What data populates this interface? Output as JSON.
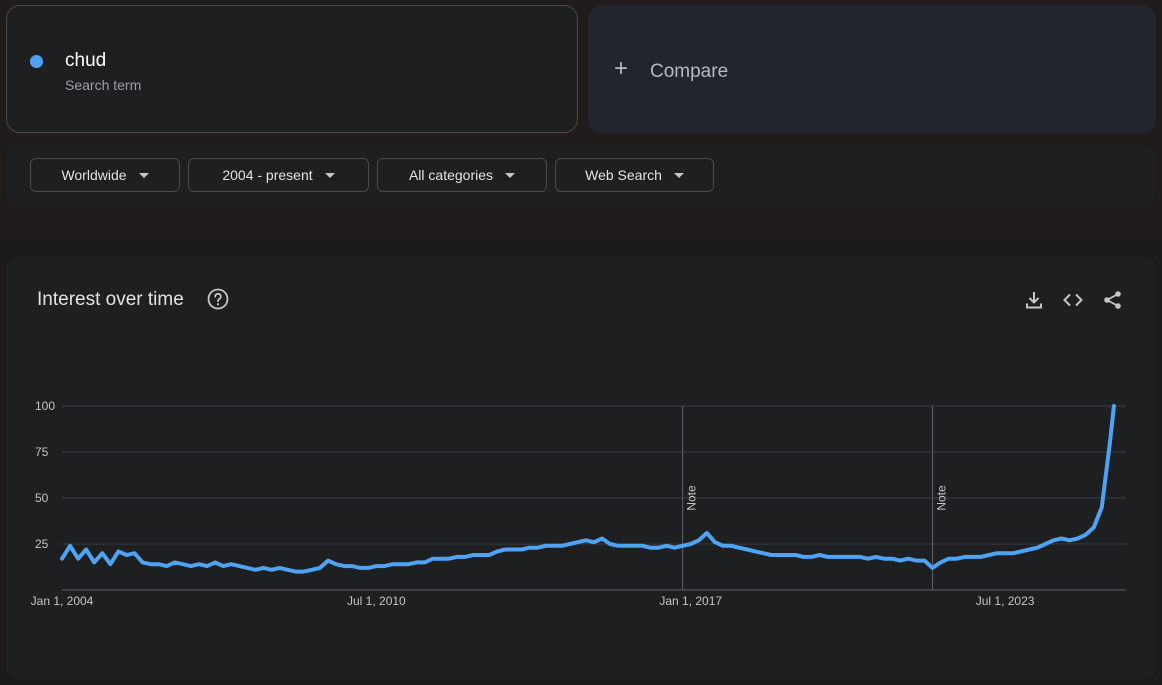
{
  "search_term": {
    "name": "chud",
    "subtitle": "Search term",
    "color": "#4ea3f5"
  },
  "compare": {
    "plus": "+",
    "label": "Compare"
  },
  "filters": {
    "region": "Worldwide",
    "time_range": "2004 - present",
    "category": "All categories",
    "search_type": "Web Search"
  },
  "chart_header": {
    "title": "Interest over time",
    "icons": [
      "help-icon",
      "download-icon",
      "embed-icon",
      "share-icon"
    ]
  },
  "chart_data": {
    "type": "line",
    "title": "",
    "xlabel": "",
    "ylabel": "",
    "ylim": [
      0,
      100
    ],
    "y_ticks": [
      100,
      75,
      50,
      25
    ],
    "x_tick_labels": [
      "Jan 1, 2004",
      "Jul 1, 2010",
      "Jan 1, 2017",
      "Jul 1, 2023"
    ],
    "x_tick_dates": [
      "2004-01",
      "2010-07",
      "2017-01",
      "2023-07"
    ],
    "grid": true,
    "legend": "none",
    "line_color": "#4ea3f5",
    "annotations": [
      {
        "label": "Note",
        "x": "2016-11"
      },
      {
        "label": "Note",
        "x": "2022-01"
      }
    ],
    "x": [
      "2004-01",
      "2004-03",
      "2004-05",
      "2004-07",
      "2004-09",
      "2004-11",
      "2005-01",
      "2005-03",
      "2005-05",
      "2005-07",
      "2005-09",
      "2005-11",
      "2006-01",
      "2006-03",
      "2006-05",
      "2006-07",
      "2006-09",
      "2006-11",
      "2007-01",
      "2007-03",
      "2007-05",
      "2007-07",
      "2007-09",
      "2007-11",
      "2008-01",
      "2008-03",
      "2008-05",
      "2008-07",
      "2008-09",
      "2008-11",
      "2009-01",
      "2009-03",
      "2009-05",
      "2009-07",
      "2009-09",
      "2009-11",
      "2010-01",
      "2010-03",
      "2010-05",
      "2010-07",
      "2010-09",
      "2010-11",
      "2011-01",
      "2011-03",
      "2011-05",
      "2011-07",
      "2011-09",
      "2011-11",
      "2012-01",
      "2012-03",
      "2012-05",
      "2012-07",
      "2012-09",
      "2012-11",
      "2013-01",
      "2013-03",
      "2013-05",
      "2013-07",
      "2013-09",
      "2013-11",
      "2014-01",
      "2014-03",
      "2014-05",
      "2014-07",
      "2014-09",
      "2014-11",
      "2015-01",
      "2015-03",
      "2015-05",
      "2015-07",
      "2015-09",
      "2015-11",
      "2016-01",
      "2016-03",
      "2016-05",
      "2016-07",
      "2016-09",
      "2016-11",
      "2017-01",
      "2017-03",
      "2017-05",
      "2017-07",
      "2017-09",
      "2017-11",
      "2018-01",
      "2018-03",
      "2018-05",
      "2018-07",
      "2018-09",
      "2018-11",
      "2019-01",
      "2019-03",
      "2019-05",
      "2019-07",
      "2019-09",
      "2019-11",
      "2020-01",
      "2020-03",
      "2020-05",
      "2020-07",
      "2020-09",
      "2020-11",
      "2021-01",
      "2021-03",
      "2021-05",
      "2021-07",
      "2021-09",
      "2021-11",
      "2022-01",
      "2022-03",
      "2022-05",
      "2022-07",
      "2022-09",
      "2022-11",
      "2023-01",
      "2023-03",
      "2023-05",
      "2023-07",
      "2023-09",
      "2023-11",
      "2024-01",
      "2024-03",
      "2024-05",
      "2024-07",
      "2024-09",
      "2024-11",
      "2025-01",
      "2025-03",
      "2025-05",
      "2025-07",
      "2025-09",
      "2025-10",
      "2025-11",
      "2025-12",
      "2026-01"
    ],
    "series": [
      {
        "values": [
          17,
          24,
          17,
          22,
          15,
          20,
          14,
          21,
          19,
          20,
          15,
          14,
          14,
          13,
          15,
          14,
          13,
          14,
          13,
          15,
          13,
          14,
          13,
          12,
          11,
          12,
          11,
          12,
          11,
          10,
          10,
          11,
          12,
          16,
          14,
          13,
          13,
          12,
          12,
          13,
          13,
          14,
          14,
          14,
          15,
          15,
          17,
          17,
          17,
          18,
          18,
          19,
          19,
          19,
          21,
          22,
          22,
          22,
          23,
          23,
          24,
          24,
          24,
          25,
          26,
          27,
          26,
          28,
          25,
          24,
          24,
          24,
          24,
          23,
          23,
          24,
          23,
          24,
          25,
          27,
          31,
          26,
          24,
          24,
          23,
          22,
          21,
          20,
          19,
          19,
          19,
          19,
          18,
          18,
          19,
          18,
          18,
          18,
          18,
          18,
          17,
          18,
          17,
          17,
          16,
          17,
          16,
          16,
          12,
          15,
          17,
          17,
          18,
          18,
          18,
          19,
          20,
          20,
          20,
          21,
          22,
          23,
          25,
          27,
          28,
          27,
          28,
          30,
          34,
          45,
          80,
          100
        ]
      }
    ]
  }
}
